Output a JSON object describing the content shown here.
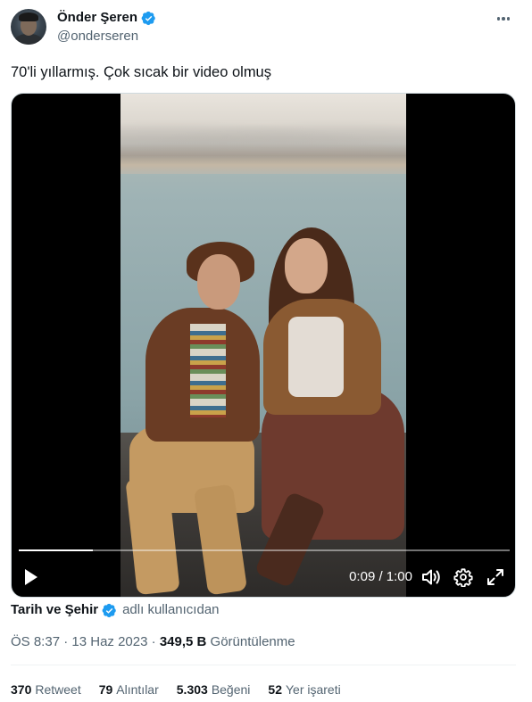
{
  "author": {
    "name": "Önder Şeren",
    "handle": "@onderseren",
    "verified": true,
    "avatar_icon": "avatar-photo"
  },
  "tweet": {
    "text": "70'li yıllarmış. Çok sıcak bir video olmuş"
  },
  "video": {
    "current_time": "0:09",
    "duration": "1:00",
    "time_display": "0:09 / 1:00",
    "progress": 0.15,
    "icons": {
      "play": "play-icon",
      "volume": "volume-icon",
      "settings": "gear-icon",
      "fullscreen": "fullscreen-icon"
    }
  },
  "source": {
    "name": "Tarih ve Şehir",
    "verified": true,
    "suffix": "adlı kullanıcıdan"
  },
  "meta": {
    "time": "ÖS 8:37",
    "separator": "·",
    "date": "13 Haz 2023",
    "views_count": "349,5 B",
    "views_label": "Görüntülenme"
  },
  "stats": {
    "retweets": {
      "count": "370",
      "label": "Retweet"
    },
    "quotes": {
      "count": "79",
      "label": "Alıntılar"
    },
    "likes": {
      "count": "5.303",
      "label": "Beğeni"
    },
    "bookmarks": {
      "count": "52",
      "label": "Yer işareti"
    }
  },
  "colors": {
    "text": "#0f1419",
    "secondary": "#536471",
    "verified_blue": "#1d9bf0",
    "divider": "#eff3f4"
  }
}
